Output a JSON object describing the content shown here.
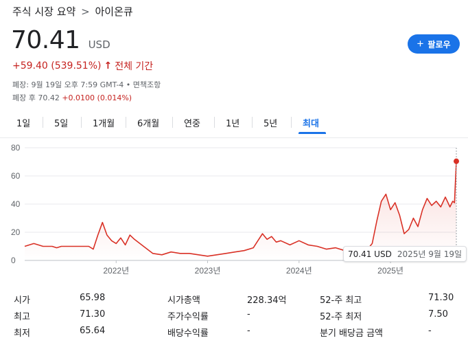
{
  "breadcrumb": {
    "parent": "주식 시장 요약",
    "separator": ">",
    "current": "아이온큐"
  },
  "quote": {
    "price": "70.41",
    "currency": "USD",
    "change": "+59.40 (539.51%)",
    "change_arrow": "↑",
    "period_label": "전체 기간",
    "closed_line": "폐장: 9월 19일 오후 7:59 GMT-4 • 면책조항",
    "after_hours_label": "폐장 후 70.42",
    "after_hours_change": "+0.0100 (0.014%)"
  },
  "follow_button": {
    "icon": "plus-icon",
    "label": "팔로우"
  },
  "tabs": [
    {
      "label": "1일"
    },
    {
      "label": "5일"
    },
    {
      "label": "1개월"
    },
    {
      "label": "6개월"
    },
    {
      "label": "연중"
    },
    {
      "label": "1년"
    },
    {
      "label": "5년"
    },
    {
      "label": "최대",
      "active": true
    }
  ],
  "tooltip": {
    "value": "70.41 USD",
    "date": "2025년 9월 19일"
  },
  "chart_data": {
    "type": "area",
    "y_ticks": [
      "80",
      "60",
      "40",
      "20",
      "0"
    ],
    "ylim": [
      0,
      80
    ],
    "x_ticks": [
      "2022년",
      "2023년",
      "2024년",
      "2025년"
    ],
    "line_color": "#d93025",
    "grid": true,
    "series": [
      {
        "x": [
          2021.0,
          2021.1,
          2021.2,
          2021.3,
          2021.35,
          2021.4,
          2021.5,
          2021.6,
          2021.7,
          2021.75,
          2021.8,
          2021.85,
          2021.9,
          2021.95,
          2022.0,
          2022.05,
          2022.1,
          2022.15,
          2022.2,
          2022.3,
          2022.4,
          2022.5,
          2022.6,
          2022.7,
          2022.8,
          2022.9,
          2023.0,
          2023.1,
          2023.2,
          2023.3,
          2023.4,
          2023.5,
          2023.55,
          2023.6,
          2023.65,
          2023.7,
          2023.75,
          2023.8,
          2023.9,
          2024.0,
          2024.1,
          2024.2,
          2024.3,
          2024.4,
          2024.5,
          2024.6,
          2024.7,
          2024.75,
          2024.8,
          2024.85,
          2024.9,
          2024.95,
          2025.0,
          2025.05,
          2025.1,
          2025.15,
          2025.2,
          2025.25,
          2025.3,
          2025.35,
          2025.4,
          2025.45,
          2025.5,
          2025.55,
          2025.6,
          2025.65,
          2025.68,
          2025.7,
          2025.72
        ],
        "values": [
          10,
          12,
          10,
          10,
          9,
          10,
          10,
          10,
          10,
          8,
          18,
          27,
          18,
          14,
          12,
          16,
          11,
          18,
          15,
          10,
          5,
          4,
          6,
          5,
          5,
          4,
          3,
          4,
          5,
          6,
          7,
          9,
          14,
          19,
          15,
          17,
          13,
          14,
          11,
          14,
          11,
          10,
          8,
          9,
          7,
          8,
          8,
          8,
          12,
          28,
          42,
          47,
          36,
          41,
          32,
          19,
          22,
          30,
          24,
          36,
          44,
          39,
          42,
          38,
          45,
          38,
          42,
          41,
          70.41
        ]
      }
    ]
  },
  "stats": [
    {
      "label": "시가",
      "value": "65.98"
    },
    {
      "label": "최고",
      "value": "71.30"
    },
    {
      "label": "최저",
      "value": "65.64"
    },
    {
      "label": "시가총액",
      "value": "228.34억"
    },
    {
      "label": "주가수익률",
      "value": "-"
    },
    {
      "label": "배당수익률",
      "value": "-"
    },
    {
      "label": "52-주 최고",
      "value": "71.30"
    },
    {
      "label": "52-주 최저",
      "value": "7.50"
    },
    {
      "label": "분기 배당금 금액",
      "value": "-"
    }
  ]
}
